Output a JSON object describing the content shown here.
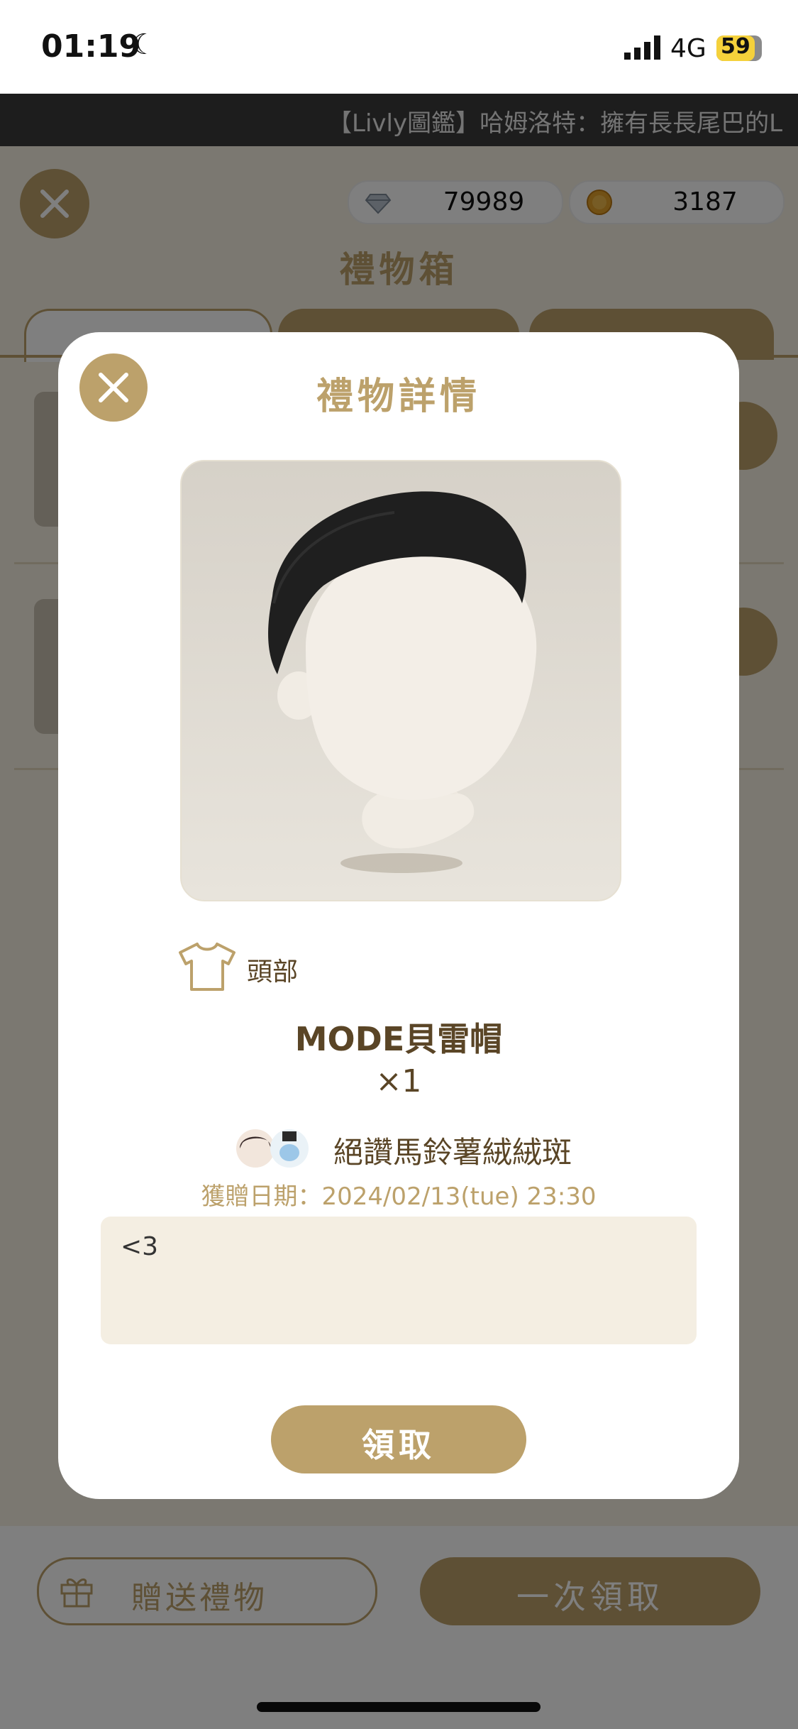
{
  "status_bar": {
    "time": "01:19",
    "network": "4G",
    "battery": "59"
  },
  "ticker": {
    "text": "【Livly圖鑑】哈姆洛特：擁有長長尾巴的L"
  },
  "background_page": {
    "gems": "79989",
    "coins": "3187",
    "title": "禮物箱",
    "send_gift_label": "贈送禮物",
    "claim_all_label": "一次領取"
  },
  "modal": {
    "title": "禮物詳情",
    "category": "頭部",
    "item_name": "MODE貝雷帽",
    "quantity": "×1",
    "sender": "絕讚馬鈴薯絨絨斑",
    "date": "獲贈日期：2024/02/13(tue) 23:30",
    "message": "<3",
    "claim_label": "領取"
  },
  "icons": {
    "close": "close-icon",
    "gem": "diamond-icon",
    "coin": "coin-icon",
    "category": "shirt-icon",
    "gift": "gift-icon"
  },
  "colors": {
    "accent": "#bca16b",
    "text_brown": "#5a4526",
    "message_bg": "#f4eee2"
  }
}
